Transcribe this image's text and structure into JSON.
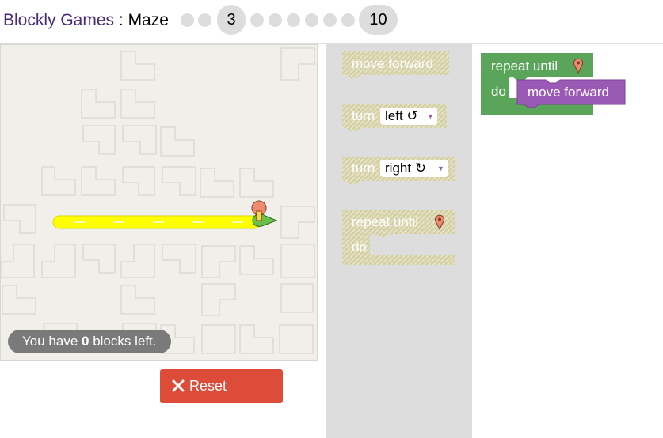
{
  "header": {
    "brand": "Blockly Games",
    "separator": " : ",
    "game": "Maze",
    "levels": [
      {
        "label": ""
      },
      {
        "label": ""
      },
      {
        "label": "3",
        "current": true
      },
      {
        "label": ""
      },
      {
        "label": ""
      },
      {
        "label": ""
      },
      {
        "label": ""
      },
      {
        "label": ""
      },
      {
        "label": ""
      },
      {
        "label": "10"
      }
    ]
  },
  "status": {
    "prefix": "You have ",
    "count": "0",
    "suffix": " blocks left."
  },
  "reset": {
    "label": "Reset"
  },
  "toolbox": {
    "move_forward": "move forward",
    "turn_left": {
      "label": "turn",
      "option": "left ↺"
    },
    "turn_right": {
      "label": "turn",
      "option": "right ↻"
    },
    "repeat_until": {
      "label": "repeat until",
      "do": "do"
    }
  },
  "workspace": {
    "repeat_until": "repeat until",
    "do": "do",
    "move_forward": "move forward"
  },
  "colors": {
    "brand": "#4a2a79",
    "movement_block": "#9b59b6",
    "loop_block": "#5ba55b",
    "reset_button": "#dd4b39",
    "path": "#ffff00"
  },
  "icons": [
    "marker-icon",
    "pegman-icon",
    "close-icon",
    "dropdown-arrow-icon"
  ]
}
